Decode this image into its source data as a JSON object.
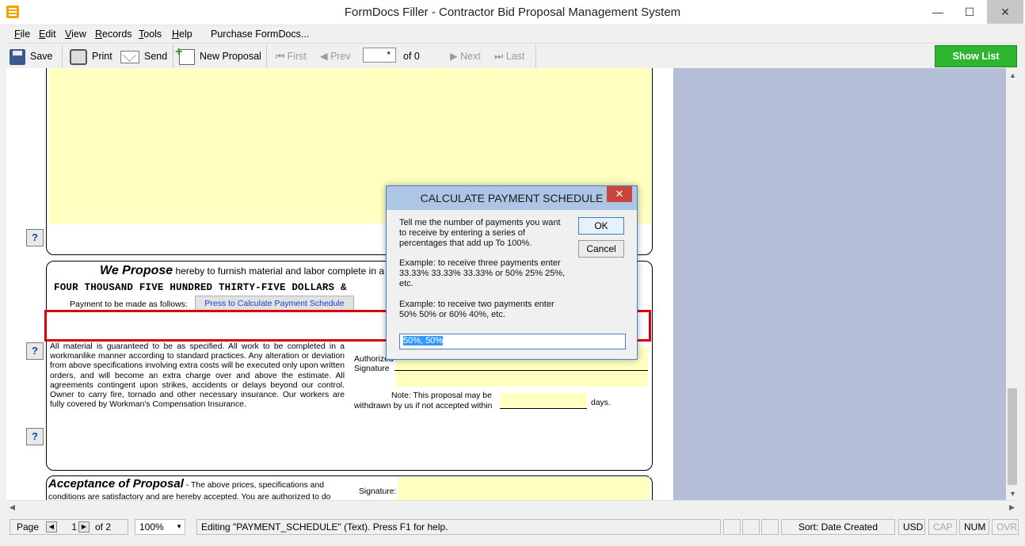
{
  "window": {
    "title": "FormDocs Filler - Contractor Bid Proposal Management System",
    "controls": {
      "minimize": "—",
      "maximize": "☐",
      "close": "✕"
    }
  },
  "menu": [
    "File",
    "Edit",
    "View",
    "Records",
    "Tools",
    "Help"
  ],
  "menu_accels": [
    "F",
    "E",
    "V",
    "R",
    "T",
    "H"
  ],
  "menu_purchase": "Purchase FormDocs...",
  "toolbar": {
    "save": "Save",
    "print": "Print",
    "send": "Send",
    "new_proposal": "New Proposal",
    "first": "First",
    "prev": "Prev",
    "record_value": "*",
    "record_of": "of 0",
    "next": "Next",
    "last": "Last",
    "show_list": "Show List"
  },
  "form": {
    "help_glyph": "?",
    "we_propose_title": "We Propose",
    "we_propose_text": "hereby to furnish material and labor complete in a",
    "amount_words": "FOUR THOUSAND FIVE HUNDRED THIRTY-FIVE DOLLARS &",
    "payment_label": "Payment to be made as follows:",
    "calc_button": "Press to Calculate Payment Schedule",
    "guarantee_text": "All material is guaranteed to be as specified. All work to be completed in a workmanlike manner according to standard practices. Any alteration or deviation from above specifications involving extra costs will be executed only upon written orders, and will become an extra charge over and above the estimate. All agreements contingent upon strikes, accidents or delays beyond our control. Owner to carry fire, tornado and other necessary insurance. Our workers are fully covered by Workman's Compensation Insurance.",
    "authorized_signature": "Authorized Signature",
    "note_line1": "Note: This proposal may be",
    "note_line2": "withdrawn by us if not accepted within",
    "days": "days.",
    "acceptance_title": "Acceptance of Proposal",
    "acceptance_text": "- The above prices, specifications and conditions are satisfactory and are hereby accepted. You are authorized to do",
    "signature_label": "Signature:"
  },
  "dialog": {
    "title": "CALCULATE PAYMENT SCHEDULE",
    "close": "✕",
    "text1": "Tell me the number of payments you want to receive by entering a series of percentages that add up To 100%.",
    "text2": "Example: to receive three payments enter 33.33% 33.33% 33.33% or 50% 25% 25%, etc.",
    "text3": "Example: to receive two payments enter 50% 50% or 60% 40%, etc.",
    "ok": "OK",
    "cancel": "Cancel",
    "input_value": "50%, 50%"
  },
  "status": {
    "page_label": "Page",
    "page_value": "1",
    "page_of": "of 2",
    "zoom": "100%",
    "message": "Editing \"PAYMENT_SCHEDULE\" (Text). Press F1 for help.",
    "sort": "Sort: Date Created",
    "usd": "USD",
    "cap": "CAP",
    "num": "NUM",
    "ovr": "OVR"
  },
  "colors": {
    "field_yellow": "#ffffc0",
    "show_list_green": "#2db52d",
    "highlight_red": "#d8000c",
    "workspace": "#b4bfd7"
  }
}
